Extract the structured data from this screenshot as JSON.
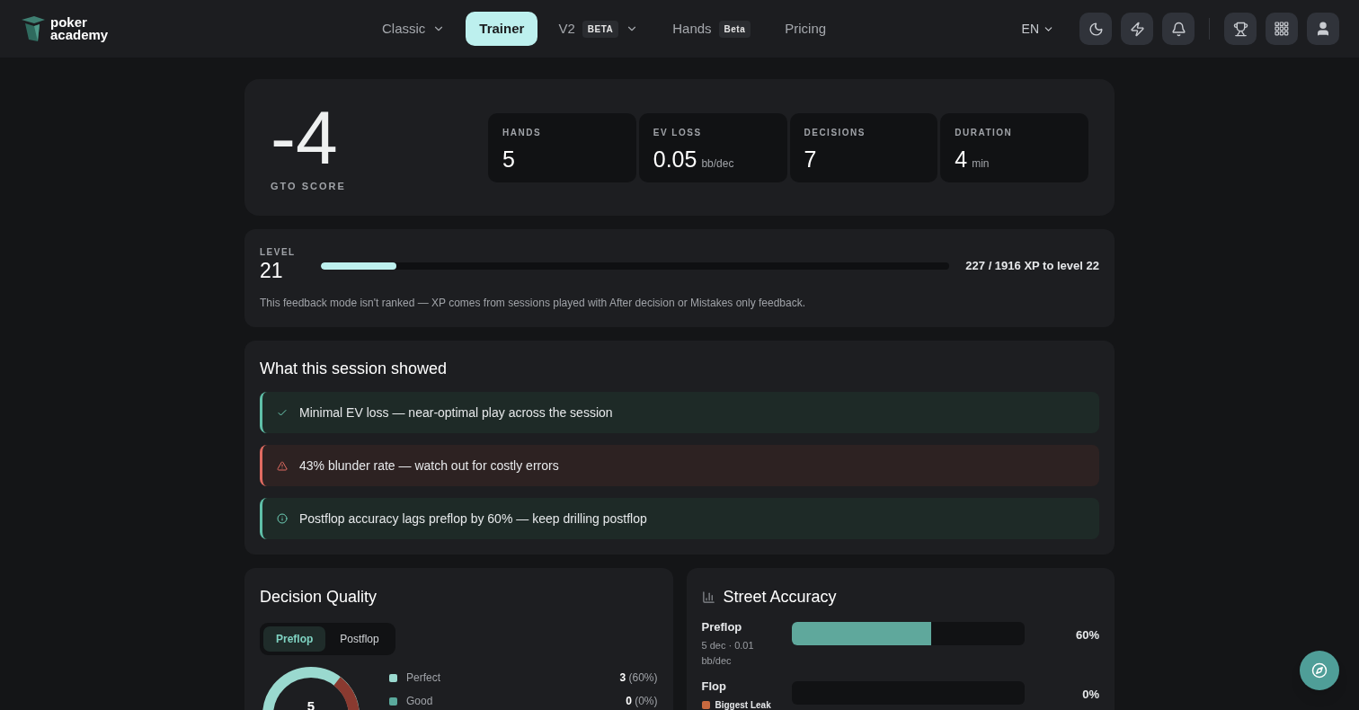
{
  "brand": {
    "line1": "poker",
    "line2": "academy"
  },
  "nav": [
    {
      "label": "Classic",
      "selected": false,
      "dropdown": true
    },
    {
      "label": "Trainer",
      "selected": true,
      "dropdown": false
    },
    {
      "label": "V2",
      "selected": false,
      "dropdown": true,
      "badge": "BETA"
    },
    {
      "label": "Hands",
      "selected": false,
      "dropdown": false,
      "badge": "Beta"
    },
    {
      "label": "Pricing",
      "selected": false,
      "dropdown": false
    }
  ],
  "language": "EN",
  "score": {
    "value": "-4",
    "label": "GTO SCORE"
  },
  "stats": [
    {
      "label": "HANDS",
      "value": "5"
    },
    {
      "label": "EV LOSS",
      "value": "0.05",
      "unit": "bb/dec"
    },
    {
      "label": "DECISIONS",
      "value": "7"
    },
    {
      "label": "DURATION",
      "value": "4",
      "unit": "min"
    }
  ],
  "level": {
    "label": "LEVEL",
    "value": "21",
    "level": 0.12,
    "progress": "227 / 1916 XP to level 22",
    "note": "This feedback mode isn't ranked — XP comes from sessions played with After decision or Mistakes only feedback."
  },
  "insights": {
    "title": "What this session showed",
    "items": [
      {
        "kind": "success",
        "text": "Minimal EV loss — near-optimal play across the session"
      },
      {
        "kind": "warning",
        "text": "43% blunder rate — watch out for costly errors"
      },
      {
        "kind": "info",
        "text": "Postflop accuracy lags preflop by 60% — keep drilling postflop"
      }
    ]
  },
  "decision_quality": {
    "title": "Decision Quality",
    "tabs": [
      {
        "label": "Preflop",
        "selected": true
      },
      {
        "label": "Postflop",
        "selected": false
      }
    ],
    "total": "5",
    "legend": [
      {
        "label": "Perfect",
        "color": "#9ad9cf",
        "count": "3",
        "share": "(60%)"
      },
      {
        "label": "Good",
        "color": "#5aa99c",
        "count": "0",
        "share": "(0%)"
      }
    ]
  },
  "street_accuracy": {
    "title": "Street Accuracy",
    "rows": [
      {
        "name": "Preflop",
        "note": "5 dec · 0.01 bb/dec",
        "level": 0.6,
        "percent": "60%"
      },
      {
        "name": "Flop",
        "tag": {
          "label": "Biggest Leak",
          "color": "#c8693f"
        },
        "level": 0,
        "percent": "0%"
      }
    ]
  }
}
